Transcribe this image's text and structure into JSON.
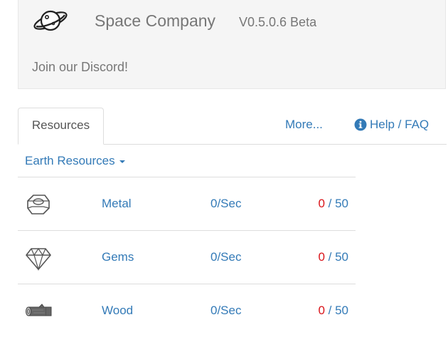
{
  "header": {
    "logo_icon": "planet-icon",
    "brand": "Space Company",
    "version": "V0.5.0.6 Beta",
    "discord_link": "Join our Discord!"
  },
  "tabs": {
    "resources": "Resources",
    "more": "More...",
    "help": "Help / FAQ",
    "help_icon": "info-circle-icon"
  },
  "panel": {
    "title": "Earth Resources",
    "rows": [
      {
        "icon": "metal-nut-icon",
        "name": "Metal",
        "rate": "0/Sec",
        "current": "0",
        "sep": " / ",
        "max": "50"
      },
      {
        "icon": "gem-icon",
        "name": "Gems",
        "rate": "0/Sec",
        "current": "0",
        "sep": " / ",
        "max": "50"
      },
      {
        "icon": "wood-log-icon",
        "name": "Wood",
        "rate": "0/Sec",
        "current": "0",
        "sep": " / ",
        "max": "50"
      }
    ]
  },
  "colors": {
    "link": "#337ab7",
    "muted_text": "#777777",
    "current_value": "#d9141a",
    "header_bg": "#f5f5f5",
    "border": "#dddddd"
  }
}
